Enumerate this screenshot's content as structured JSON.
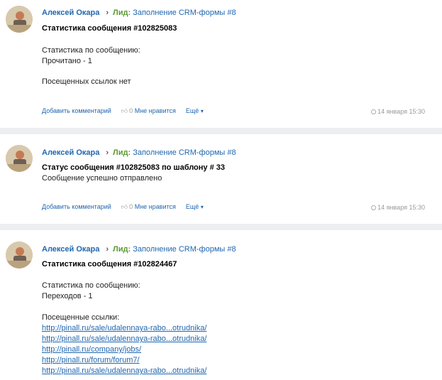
{
  "posts": [
    {
      "author": "Алексей Окара",
      "lead_label": "Лид:",
      "lead_link": "Заполнение CRM-формы #8",
      "title": "Статистика сообщения #102825083",
      "lines": [
        "Статистика по сообщению:",
        "Прочитано - 1",
        "Посещенных ссылок нет"
      ],
      "actions": {
        "comment": "Добавить комментарий",
        "like_count": "0",
        "like": "Мне нравится",
        "more": "Ещё"
      },
      "time": "14 января 15:30"
    },
    {
      "author": "Алексей Окара",
      "lead_label": "Лид:",
      "lead_link": "Заполнение CRM-формы #8",
      "title": "Статус сообщения #102825083 по шаблону # 33",
      "lines": [
        "Сообщение успешно отправлено"
      ],
      "actions": {
        "comment": "Добавить комментарий",
        "like_count": "0",
        "like": "Мне нравится",
        "more": "Ещё"
      },
      "time": "14 января 15:30"
    },
    {
      "author": "Алексей Окара",
      "lead_label": "Лид:",
      "lead_link": "Заполнение CRM-формы #8",
      "title": "Статистика сообщения #102824467",
      "lines": [
        "Статистика по сообщению:",
        "Переходов - 1",
        "Посещенные ссылки:"
      ],
      "links": [
        "http://pinall.ru/sale/udalennaya-rabo...otrudnika/",
        "http://pinall.ru/sale/udalennaya-rabo...otrudnika/",
        "http://pinall.ru/company/jobs/",
        "http://pinall.ru/forum/forum7/",
        "http://pinall.ru/sale/udalennaya-rabo...otrudnika/"
      ]
    }
  ],
  "colors": {
    "link": "#2067b0",
    "lead_label": "#5a9b34",
    "separator": "#edeef0"
  }
}
